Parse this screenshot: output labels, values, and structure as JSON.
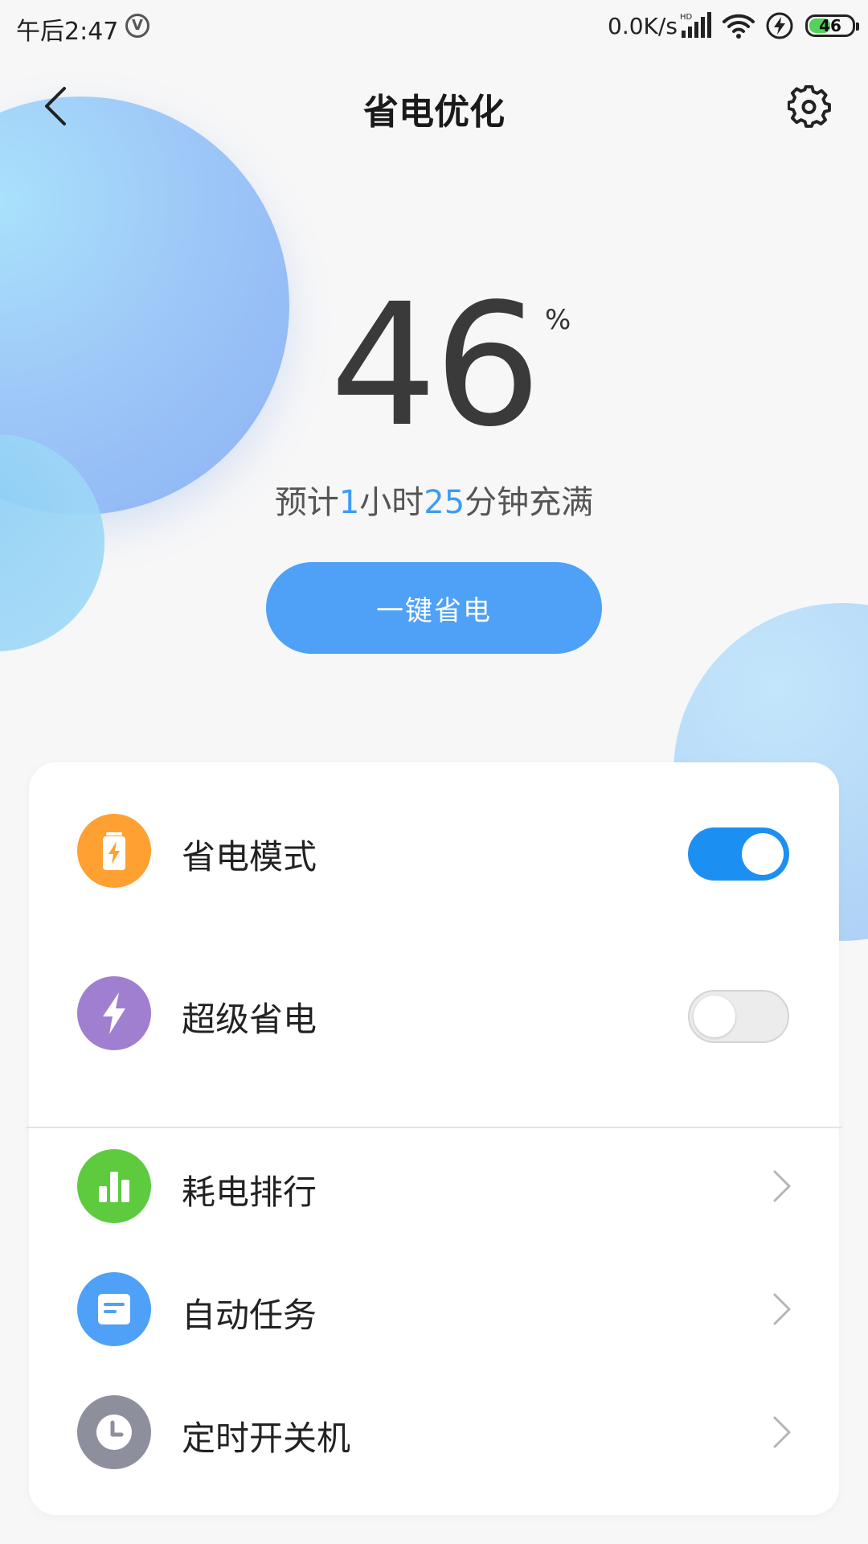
{
  "status_bar": {
    "time": "午后2:47",
    "v_badge": "V",
    "net_speed": "0.0K/s",
    "signal_badge": "HD",
    "battery_level": "46"
  },
  "header": {
    "title": "省电优化"
  },
  "battery": {
    "percent": "46",
    "percent_sign": "%",
    "estimate_prefix": "预计",
    "estimate_hours": "1",
    "estimate_mid": "小时",
    "estimate_minutes": "25",
    "estimate_suffix": "分钟充满"
  },
  "cta": {
    "label": "一键省电"
  },
  "settings": {
    "toggles": [
      {
        "label": "省电模式",
        "on": true,
        "color": "#ffa033",
        "icon": "battery-bolt-icon"
      },
      {
        "label": "超级省电",
        "on": false,
        "color": "#a07fd0",
        "icon": "bolt-icon"
      }
    ],
    "links": [
      {
        "label": "耗电排行",
        "color": "#5ecb3f",
        "icon": "bar-chart-icon"
      },
      {
        "label": "自动任务",
        "color": "#4ea1f7",
        "icon": "document-icon"
      },
      {
        "label": "定时开关机",
        "color": "#8e8f9c",
        "icon": "clock-icon"
      }
    ]
  },
  "colors": {
    "accent": "#4ea1f7",
    "toggle_on": "#1c8ff2",
    "highlight_text": "#3d9cf5"
  }
}
